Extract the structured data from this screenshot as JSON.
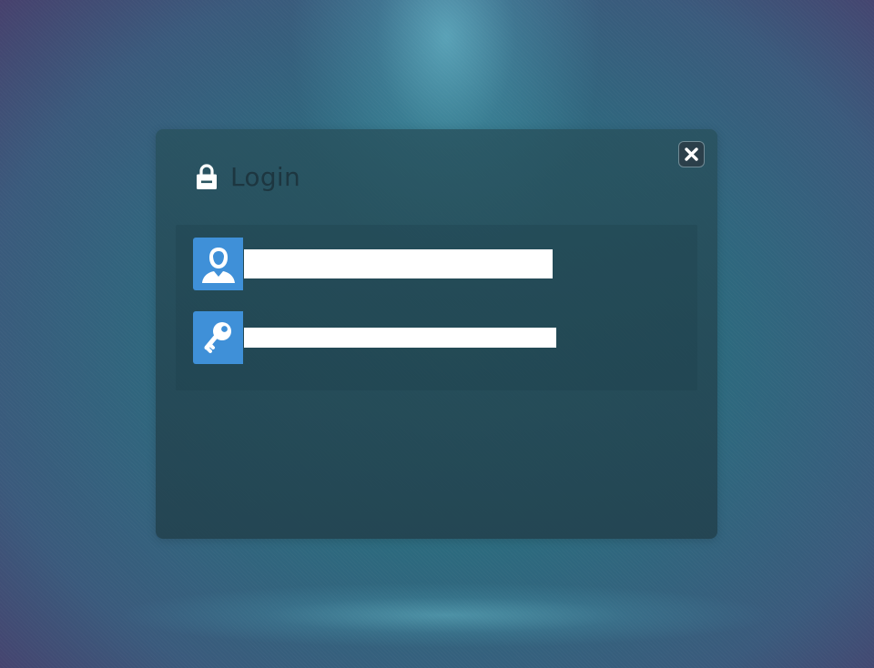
{
  "dialog": {
    "title": "Login",
    "title_icon": "lock-icon",
    "close_icon": "close-icon"
  },
  "form": {
    "username": {
      "icon": "user-icon",
      "value": "",
      "placeholder": ""
    },
    "password": {
      "icon": "key-icon",
      "value": "",
      "placeholder": ""
    }
  },
  "colors": {
    "field_icon_bg": "#3f90d8",
    "title_text": "#1d3640",
    "input_bg": "#ffffff"
  }
}
